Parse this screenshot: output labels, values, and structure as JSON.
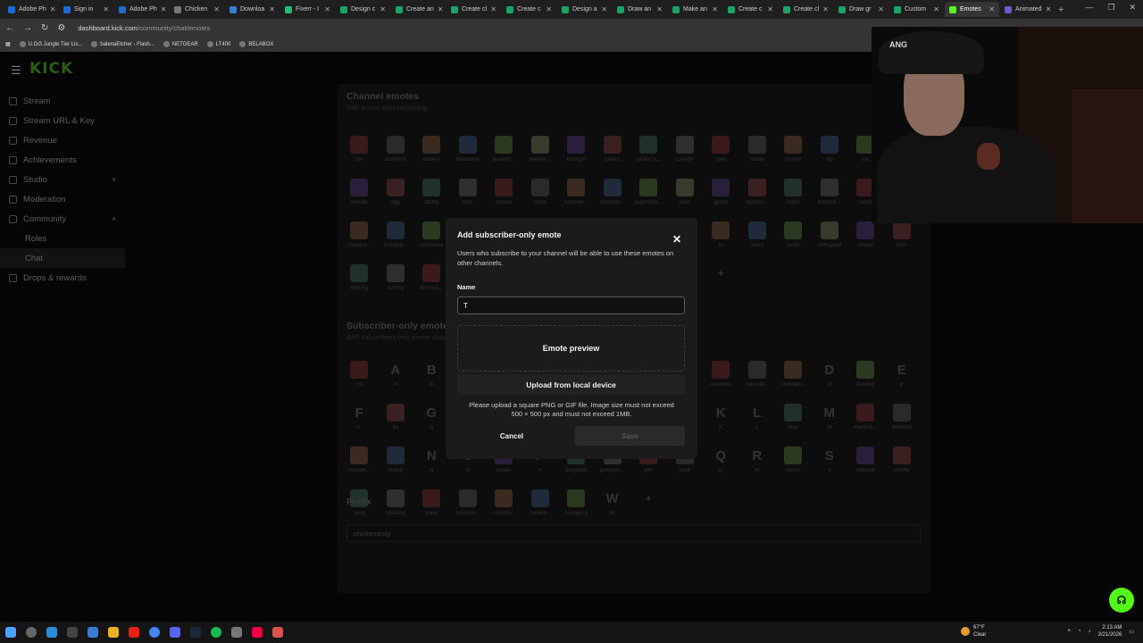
{
  "browser": {
    "tabs": [
      {
        "label": "Adobe Ph",
        "color": "#1a6cd8"
      },
      {
        "label": "Sign in",
        "color": "#1a6cd8"
      },
      {
        "label": "Adobe Ph",
        "color": "#1a6cd8"
      },
      {
        "label": "Chicken",
        "color": "#777777"
      },
      {
        "label": "Downloa",
        "color": "#3a7bd5"
      },
      {
        "label": "Fiverr - I",
        "color": "#1dbf73"
      },
      {
        "label": "Design c",
        "color": "#18a566"
      },
      {
        "label": "Create an",
        "color": "#18a566"
      },
      {
        "label": "Create cl",
        "color": "#18a566"
      },
      {
        "label": "Create c",
        "color": "#18a566"
      },
      {
        "label": "Design a",
        "color": "#18a566"
      },
      {
        "label": "Draw an",
        "color": "#18a566"
      },
      {
        "label": "Make an",
        "color": "#18a566"
      },
      {
        "label": "Create c",
        "color": "#18a566"
      },
      {
        "label": "Create cl",
        "color": "#18a566"
      },
      {
        "label": "Draw gr",
        "color": "#18a566"
      },
      {
        "label": "Custom",
        "color": "#18a566"
      },
      {
        "label": "Emotes",
        "color": "#53fc18"
      },
      {
        "label": "Animated",
        "color": "#6a5acd"
      }
    ],
    "active_tab_index": 17,
    "url_host": "dashboard.kick.com",
    "url_path": "/community/chat/emotes",
    "bookmarks": [
      "U.GG Jungle Tier Lis...",
      "balenaEtcher - Flash...",
      "NETGEAR",
      "LT400",
      "BELABOX"
    ]
  },
  "sidebar": {
    "logo": "KICK",
    "items": [
      {
        "label": "Stream"
      },
      {
        "label": "Stream URL & Key"
      },
      {
        "label": "Revenue"
      },
      {
        "label": "Achievements"
      },
      {
        "label": "Studio",
        "chevron": "˅"
      },
      {
        "label": "Moderation"
      },
      {
        "label": "Community",
        "chevron": "˄"
      },
      {
        "label": "Roles",
        "sub": true
      },
      {
        "label": "Chat",
        "sub": true,
        "active": true
      },
      {
        "label": "Drops & rewards"
      }
    ]
  },
  "channel_emotes": {
    "title": "Channel emotes",
    "subtitle": "3/80 emote slots remaining",
    "items": [
      "ibe",
      "andydick",
      "battery",
      "bladestoe",
      "bladeth...",
      "breakin...",
      "budlight",
      "callers",
      "caseyca...",
      "CaseyP",
      "cash",
      "chase",
      "chicken",
      "cig",
      "cin",
      "",
      "donate",
      "egg",
      "fastfly",
      "fatig",
      "firesale",
      "fzone",
      "homede...",
      "homede...",
      "jegermeis...",
      "jbald",
      "jjpimp",
      "lighters...",
      "maco",
      "mandoe...",
      "mand",
      "",
      "milwauk...",
      "muhapp...",
      "muhboots",
      "",
      "",
      "",
      "",
      "",
      "",
      "",
      "rv",
      "Saint",
      "script",
      "selfhapper",
      "smoke",
      "sour",
      "thinking",
      "Tommy",
      "tommys...",
      "",
      "",
      "",
      "",
      "",
      "",
      "",
      "+"
    ]
  },
  "subscriber_emotes": {
    "title": "Subscriber-only emotes",
    "subtitle": "4/60 subscribers only emote slots remaining",
    "items": [
      "7/11",
      "A",
      "B",
      "",
      "",
      "",
      "",
      "",
      "",
      "",
      "cocktails",
      "countdo...",
      "crabdan...",
      "D",
      "donotsy",
      "E",
      "F",
      "fbi",
      "G",
      "",
      "",
      "",
      "",
      "",
      "",
      "",
      "K",
      "L",
      "logo",
      "M",
      "mandoli...",
      "mexican",
      "monkas...",
      "mubgf",
      "N",
      "O",
      "ocean",
      "P",
      "partyblob",
      "peepoen...",
      "per",
      "ptsd",
      "Q",
      "R",
      "roach",
      "S",
      "Sabbath",
      "shuffle",
      "simp",
      "smoking",
      "stake",
      "tacostra...",
      "Thumbs...",
      "TriHard...",
      "trumppog",
      "W",
      "+"
    ]
  },
  "prefix": {
    "title": "Prefix",
    "value": "chickenandy"
  },
  "webcam": {
    "cap_text": "ANG"
  },
  "modal": {
    "title": "Add subscriber-only emote",
    "close_glyph": "✕",
    "description": "Users who subscribe to your channel will be able to use these emotes on other channels.",
    "name_label": "Name",
    "name_value": "T",
    "preview_label": "Emote preview",
    "upload_label": "Upload from local device",
    "hint": "Please upload a square PNG or GIF file. Image size must not exceed 500 × 500 px and must not exceed 1MB.",
    "cancel_label": "Cancel",
    "save_label": "Save"
  },
  "taskbar": {
    "weather_temp": "67°F",
    "weather_desc": "Clear",
    "time": "2:13 AM",
    "date": "3/21/2026"
  },
  "colors": {
    "brand": "#53fc18",
    "modal_bg": "#1b1b1b"
  }
}
